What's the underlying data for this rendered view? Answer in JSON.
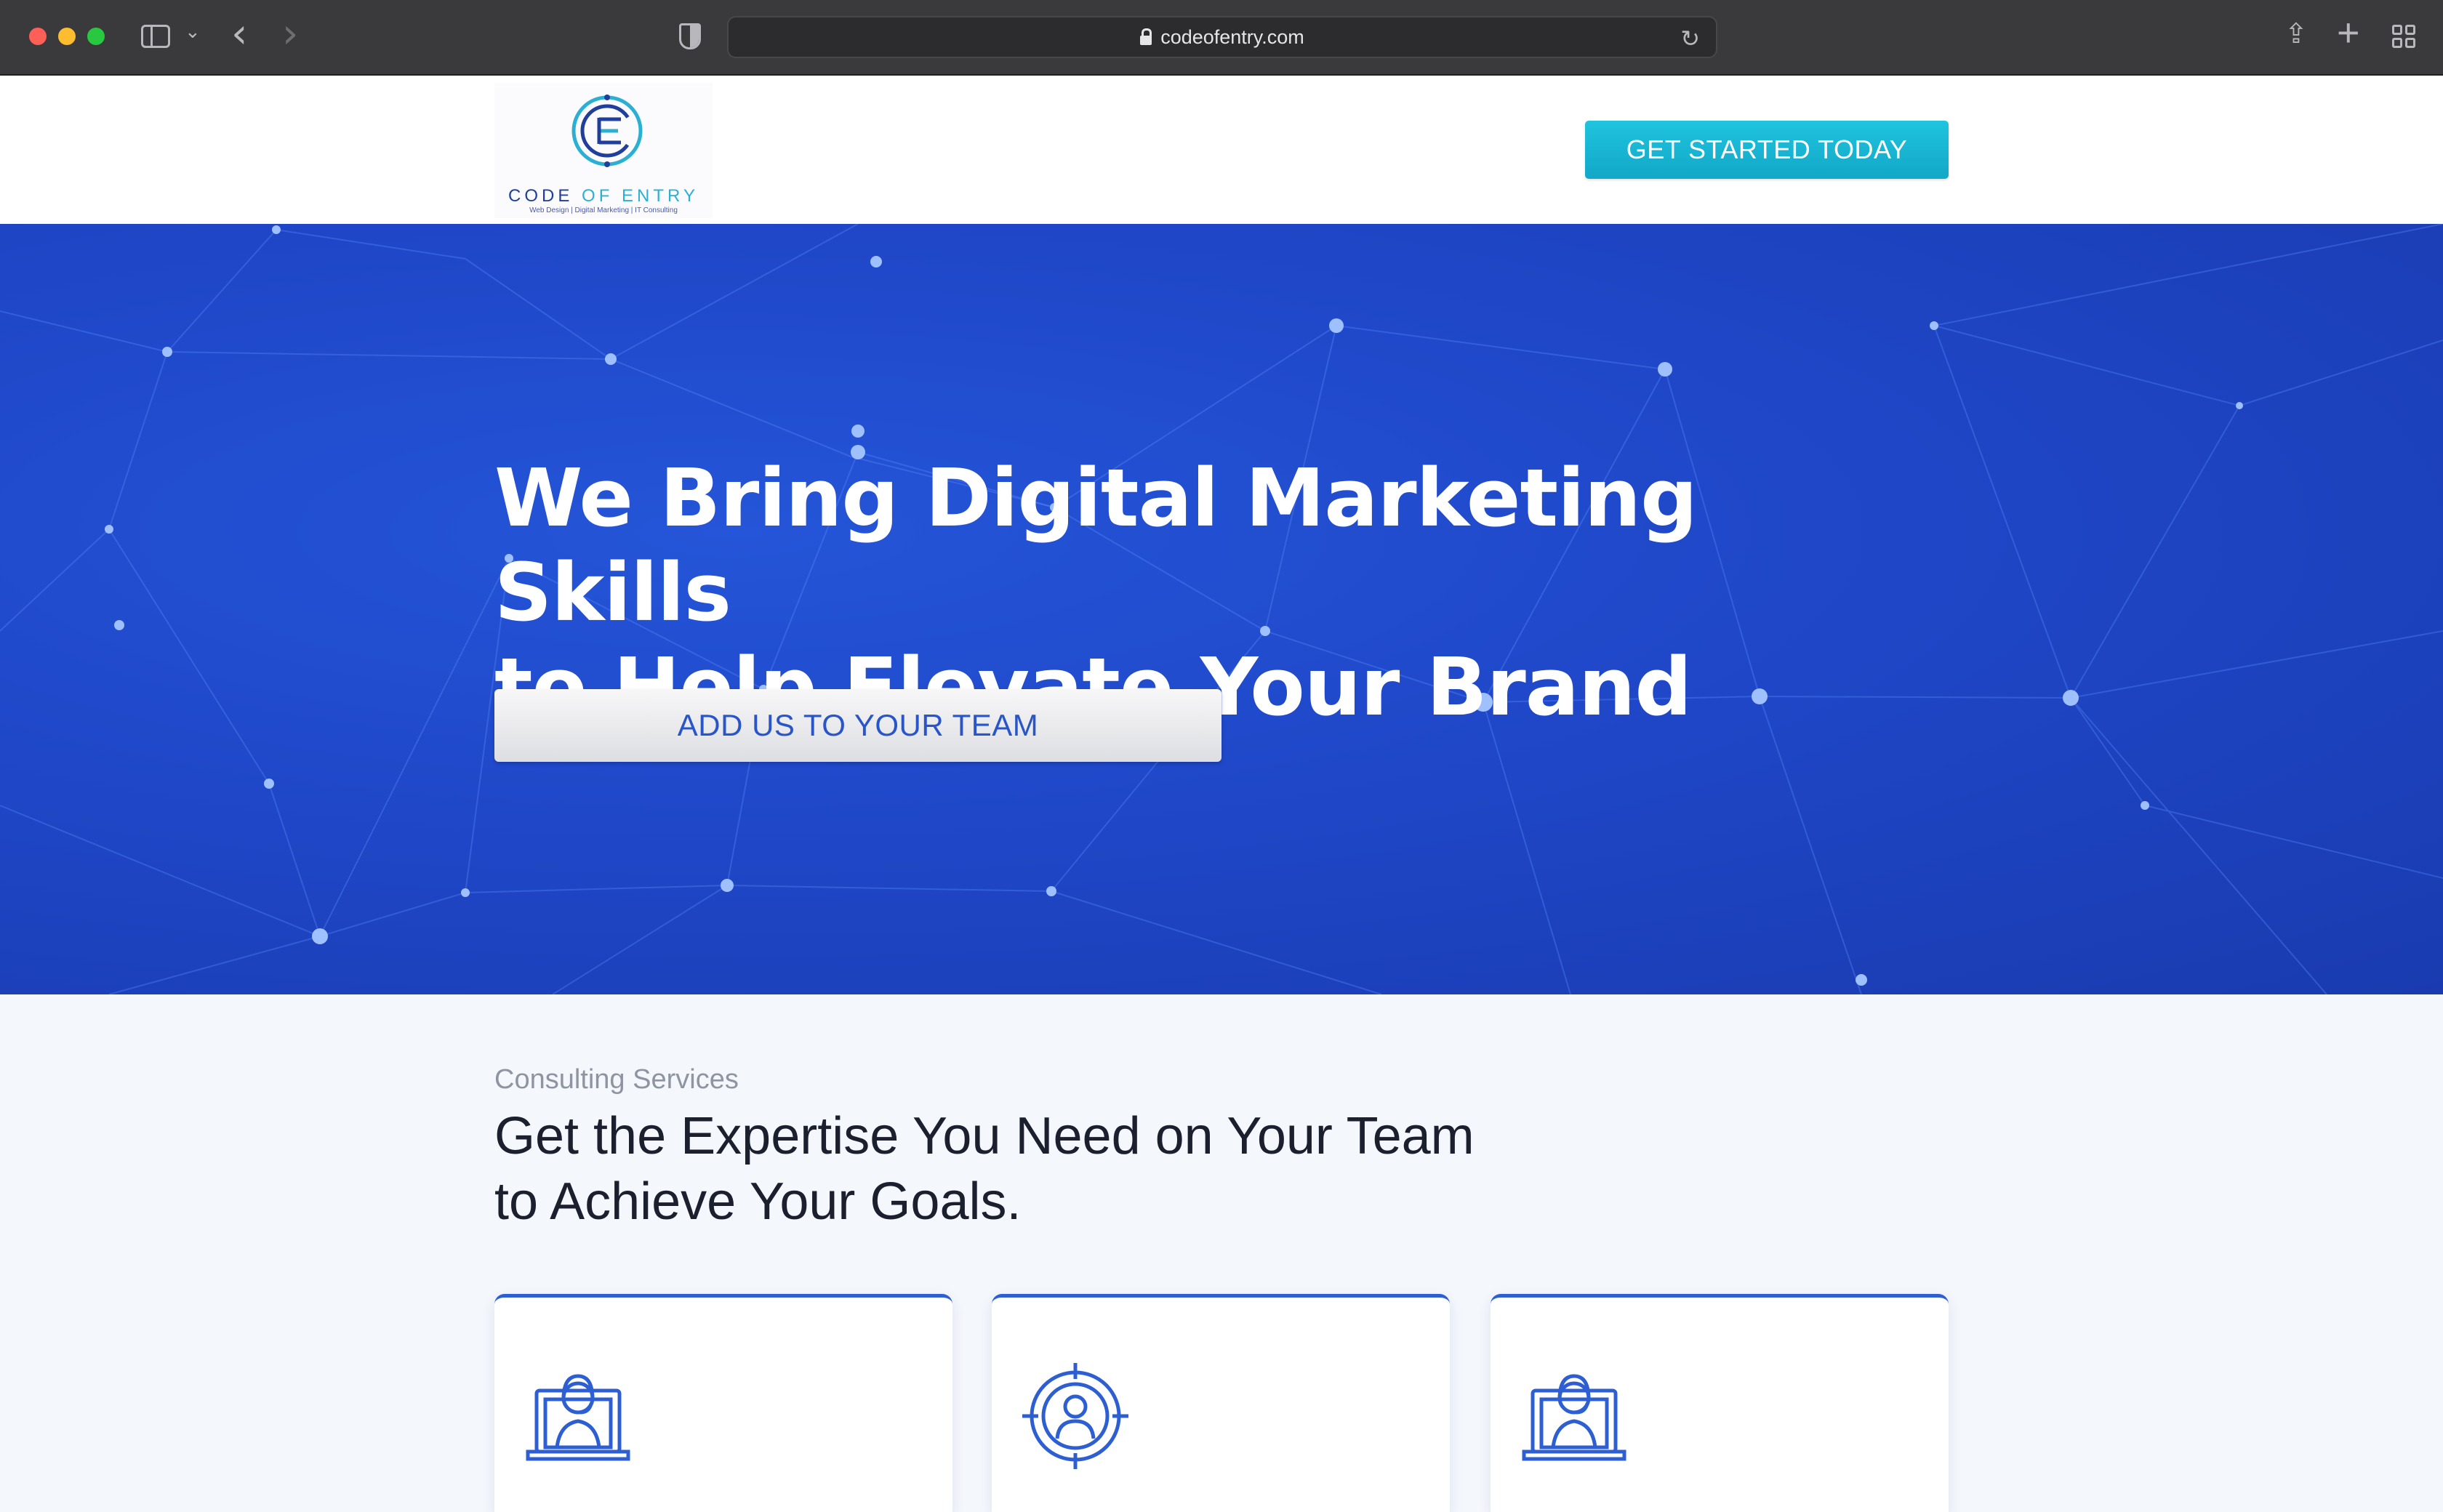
{
  "browser": {
    "url": "codeofentry.com",
    "icons": [
      "sidebar-icon",
      "chevron-down-icon",
      "back-icon",
      "forward-icon",
      "shield-icon",
      "lock-icon",
      "reload-icon",
      "share-icon",
      "new-tab-icon",
      "tab-overview-icon"
    ]
  },
  "header": {
    "logo": {
      "name_part1": "CODE ",
      "name_part2": "OF ENTRY",
      "tagline": "Web Design | Digital Marketing | IT Consulting"
    },
    "cta_label": "GET STARTED TODAY"
  },
  "hero": {
    "title_line1": "We Bring Digital Marketing Skills",
    "title_line2": "to Help Elevate Your Brand",
    "button_label": "ADD US TO YOUR TEAM"
  },
  "services": {
    "eyebrow": "Consulting Services",
    "title_line1": "Get the Expertise You Need on Your Team",
    "title_line2": "to Achieve Your Goals.",
    "cards": [
      {
        "icon": "support-agent-laptop-icon"
      },
      {
        "icon": "target-user-icon"
      },
      {
        "icon": "support-agent-laptop-icon"
      }
    ]
  },
  "colors": {
    "hero_bg": "#1f47c8",
    "cta_bg": "#17b6d3",
    "accent_blue": "#2d5fd3",
    "title_dark": "#1b1f2e"
  }
}
